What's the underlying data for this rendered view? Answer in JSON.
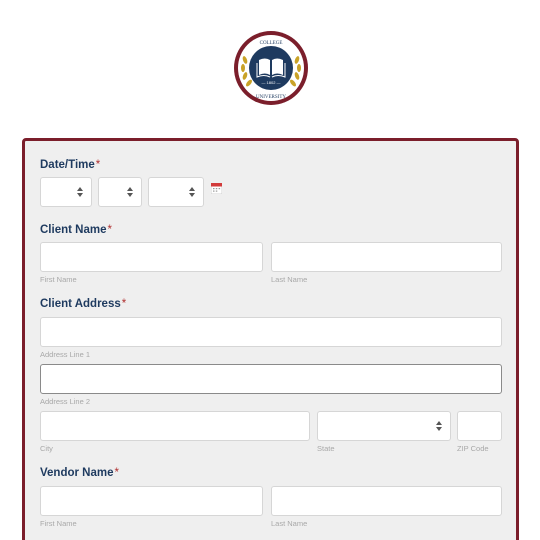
{
  "colors": {
    "accent": "#7b1e2b",
    "label": "#1e3a5f",
    "required": "#b03030"
  },
  "logo": {
    "top_text": "COLLEGE",
    "bottom_text": "UNIVERSITY",
    "year": "— 1802 —",
    "icon": "open-book-icon"
  },
  "form": {
    "datetime": {
      "label": "Date/Time",
      "required": "*",
      "icon": "calendar-icon"
    },
    "client_name": {
      "label": "Client Name",
      "required": "*",
      "first": "First Name",
      "last": "Last Name"
    },
    "client_address": {
      "label": "Client Address",
      "required": "*",
      "line1": "Address Line 1",
      "line2": "Address Line 2",
      "city": "City",
      "state": "State",
      "zip": "ZIP Code"
    },
    "vendor_name": {
      "label": "Vendor Name",
      "required": "*",
      "first": "First Name",
      "last": "Last Name"
    }
  }
}
